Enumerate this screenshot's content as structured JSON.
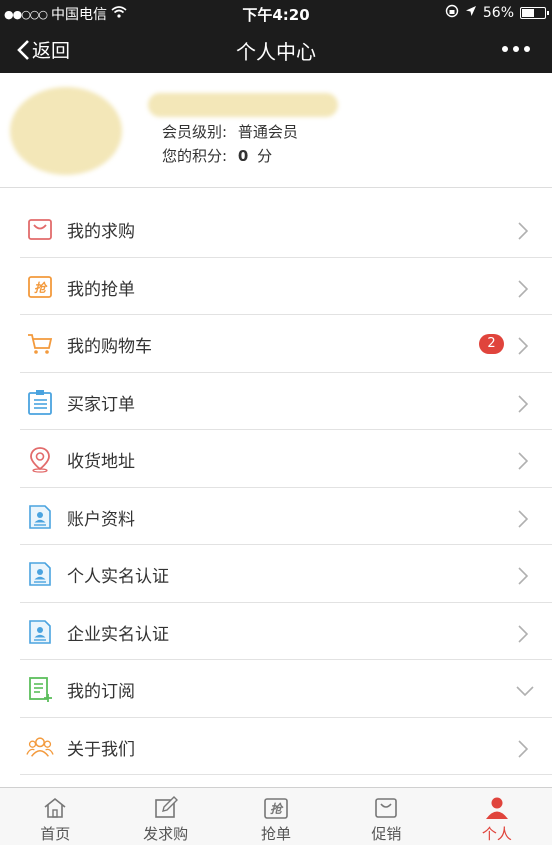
{
  "status_bar": {
    "carrier": "中国电信",
    "time": "下午4:20",
    "battery": "56%",
    "battery_level": 0.56
  },
  "nav": {
    "back_label": "返回",
    "title": "个人中心"
  },
  "profile": {
    "level_label": "会员级别:",
    "level_value": "普通会员",
    "points_label": "您的积分:",
    "points_value": "0",
    "points_unit": "分"
  },
  "menu": [
    {
      "label": "我的求购",
      "icon": "shopping-bag-icon",
      "color": "#e26b6b"
    },
    {
      "label": "我的抢单",
      "icon": "grab-order-icon",
      "color": "#f39a3d"
    },
    {
      "label": "我的购物车",
      "icon": "cart-icon",
      "color": "#f39a3d",
      "badge": "2"
    },
    {
      "label": "买家订单",
      "icon": "clipboard-list-icon",
      "color": "#4aa3df"
    },
    {
      "label": "收货地址",
      "icon": "location-pin-icon",
      "color": "#e26b6b"
    },
    {
      "label": "账户资料",
      "icon": "id-card-icon",
      "color": "#4aa3df"
    },
    {
      "label": "个人实名认证",
      "icon": "id-card-icon",
      "color": "#4aa3df"
    },
    {
      "label": "企业实名认证",
      "icon": "id-card-icon",
      "color": "#4aa3df"
    },
    {
      "label": "我的订阅",
      "icon": "subscribe-icon",
      "color": "#5cbf5c"
    },
    {
      "label": "关于我们",
      "icon": "users-icon",
      "color": "#f39a3d"
    }
  ],
  "tabs": [
    {
      "label": "首页",
      "icon": "home-icon"
    },
    {
      "label": "发求购",
      "icon": "edit-icon"
    },
    {
      "label": "抢单",
      "icon": "grab-order-icon"
    },
    {
      "label": "促销",
      "icon": "shopping-bag-icon"
    },
    {
      "label": "个人",
      "icon": "person-icon",
      "active": true
    }
  ],
  "colors": {
    "header_bg": "#1c1c1c",
    "accent_red": "#e0443c"
  }
}
